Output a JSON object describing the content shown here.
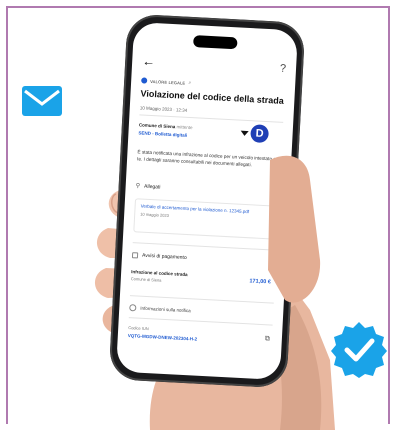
{
  "screen": {
    "help_label": "?",
    "tag": "VALORE LEGALE",
    "title": "Violazione del codice della strada",
    "date": "10 Maggio 2023 · 12:34",
    "sender_name": "Comune di Siena",
    "sender_meta": "mittente",
    "sender_code": "SEND - Bolletta digitali",
    "logo_letter": "D",
    "body_text": "È stata notificata una infrazione al codice per un veicolo intestato a te. I dettagli saranno consultabili nei documenti allegati.",
    "attachments_label": "Allegati",
    "document_link": "Verbale di accertamento per la violazione n. 12345.pdf",
    "document_date": "10 maggio 2023",
    "payment_notices_label": "Avvisi di pagamento",
    "payment_title": "Infrazione al codice strada",
    "payment_sub": "Comune di Siena",
    "payment_amount": "171,00 €",
    "info_label": "Informazioni sulla notifica",
    "iun_label": "Codice IUN",
    "iun_value": "VQTG-MGDW-DNEW-202304-H-2"
  },
  "colors": {
    "brand_blue": "#1f5bd1",
    "mail_icon": "#1aa3e8",
    "badge": "#1aa3e8",
    "frame": "#b07ab0"
  },
  "icons": [
    "mail-icon",
    "verified-badge-icon",
    "back-arrow-icon",
    "help-icon",
    "paperclip-icon",
    "copy-icon"
  ]
}
